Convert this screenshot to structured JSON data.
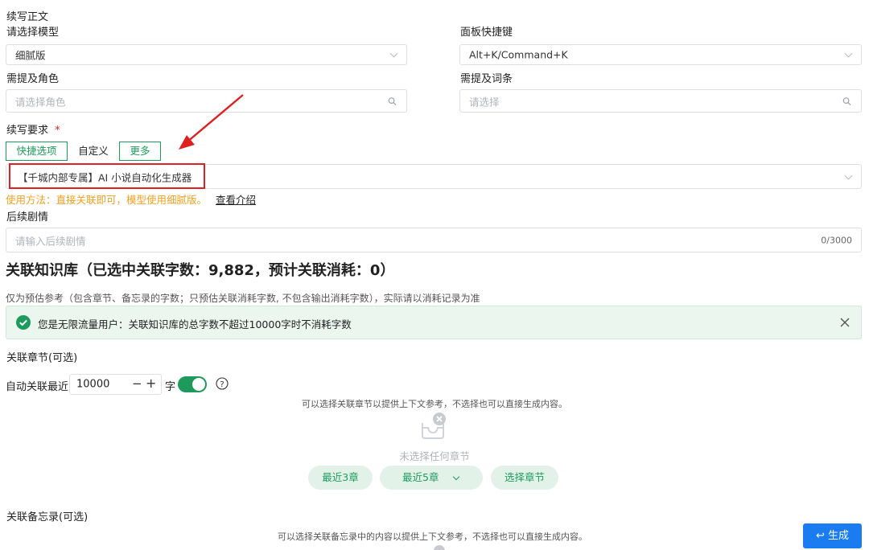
{
  "section_title": "续写正文",
  "model": {
    "label": "请选择模型",
    "value": "细腻版"
  },
  "hotkey": {
    "label": "面板快捷键",
    "value": "Alt+K/Command+K"
  },
  "roles": {
    "label": "需提及角色",
    "placeholder": "请选择角色"
  },
  "terms": {
    "label": "需提及词条",
    "placeholder": "请选择"
  },
  "requirement": {
    "label": "续写要求",
    "required_mark": "*",
    "tabs": [
      "快捷选项",
      "自定义",
      "更多"
    ],
    "selected": "【千城内部专属】AI 小说自动化生成器",
    "usage_note": "使用方法：直接关联即可，模型使用细腻版。",
    "intro_link": "查看介绍"
  },
  "plot": {
    "label": "后续剧情",
    "placeholder": "请输入后续剧情",
    "counter": "0/3000"
  },
  "knowledge": {
    "title": "关联知识库（已选中关联字数：9,882，预计关联消耗：0）",
    "note": "仅为预估参考（包含章节、备忘录的字数；只预估关联消耗字数, 不包含输出消耗字数），实际请以消耗记录为准",
    "alert": "您是无限流量用户：关联知识库的总字数不超过10000字时不消耗字数"
  },
  "chapters": {
    "label": "关联章节(可选)",
    "auto_label": "自动关联最近",
    "auto_value": "10000",
    "unit": "字",
    "toggle_on": true,
    "hint": "可以选择关联章节以提供上下文参考，不选择也可以直接生成内容。",
    "empty": "未选择任何章节",
    "btn_recent3": "最近3章",
    "btn_recent5": "最近5章",
    "btn_select": "选择章节"
  },
  "memos": {
    "label": "关联备忘录(可选)",
    "hint": "可以选择关联备忘录中的内容以提供上下文参考，不选择也可以直接生成内容。"
  },
  "generate_button": "↩ 生成",
  "colors": {
    "accent": "#1e9b5c",
    "warning": "#f0a020",
    "primary": "#1a7cf0",
    "annotation": "#e02020"
  }
}
